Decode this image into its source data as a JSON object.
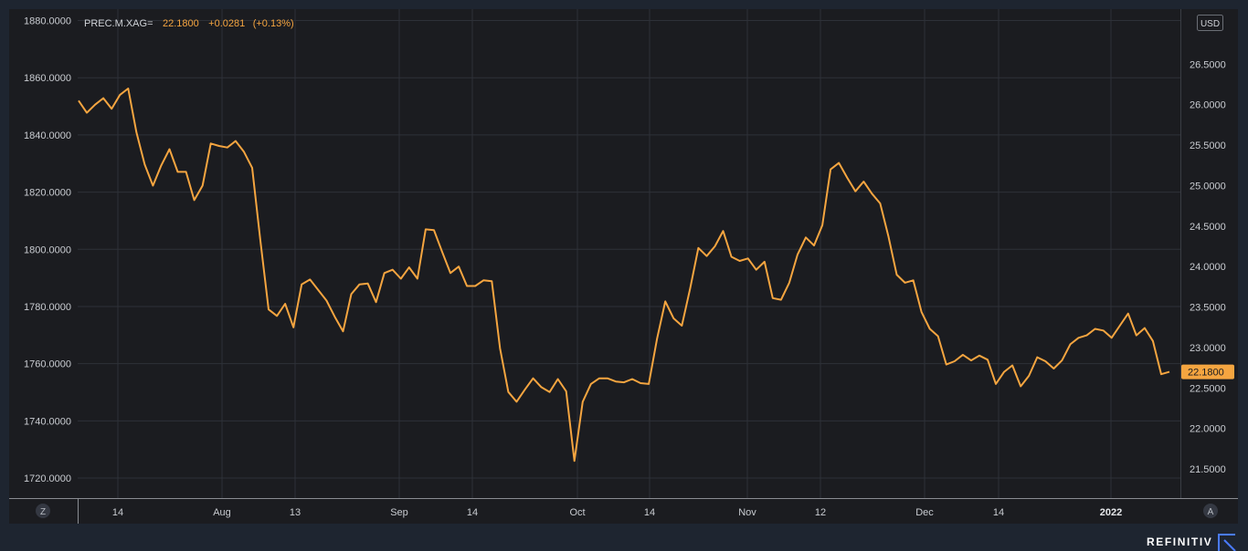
{
  "header": {
    "symbol": "PREC.M.XAG=",
    "last": "22.1800",
    "change": "+0.0281",
    "change_pct": "(+0.13%)"
  },
  "currency_badge": "USD",
  "last_price_tag": "22.1800",
  "zoom_button": "Z",
  "autoscale_button": "A",
  "brand": "REFINITIV",
  "colors": {
    "background": "#1e2530",
    "plot": "#1b1c20",
    "line": "#f5a540",
    "grid": "#2e3138"
  },
  "chart_data": {
    "type": "line",
    "left_axis": {
      "range": [
        1713,
        1884
      ],
      "ticks": [
        "1880.0000",
        "1860.0000",
        "1840.0000",
        "1820.0000",
        "1800.0000",
        "1780.0000",
        "1760.0000",
        "1740.0000",
        "1720.0000"
      ]
    },
    "right_axis": {
      "range": [
        21.14,
        27.18
      ],
      "ticks": [
        "26.5000",
        "26.0000",
        "25.5000",
        "25.0000",
        "24.5000",
        "24.0000",
        "23.5000",
        "23.0000",
        "22.5000",
        "22.0000",
        "21.5000"
      ]
    },
    "x_ticks": [
      {
        "label": "14",
        "bold": false
      },
      {
        "label": "Aug",
        "bold": false
      },
      {
        "label": "13",
        "bold": false
      },
      {
        "label": "Sep",
        "bold": false
      },
      {
        "label": "14",
        "bold": false
      },
      {
        "label": "Oct",
        "bold": false
      },
      {
        "label": "14",
        "bold": false
      },
      {
        "label": "Nov",
        "bold": false
      },
      {
        "label": "12",
        "bold": false
      },
      {
        "label": "Dec",
        "bold": false
      },
      {
        "label": "14",
        "bold": false
      },
      {
        "label": "2022",
        "bold": true
      }
    ],
    "grid": true,
    "series": [
      {
        "values": [
          26.05,
          25.9,
          26.0,
          26.08,
          25.95,
          26.12,
          26.2,
          25.66,
          25.26,
          25.0,
          25.25,
          25.45,
          25.17,
          25.17,
          24.82,
          25.0,
          25.52,
          25.49,
          25.47,
          25.55,
          25.42,
          25.22,
          24.32,
          23.47,
          23.39,
          23.54,
          23.25,
          23.78,
          23.84,
          23.71,
          23.58,
          23.38,
          23.2,
          23.66,
          23.78,
          23.79,
          23.56,
          23.92,
          23.96,
          23.85,
          23.99,
          23.85,
          24.46,
          24.45,
          24.18,
          23.92,
          24.0,
          23.76,
          23.76,
          23.83,
          23.82,
          22.99,
          22.45,
          22.33,
          22.48,
          22.62,
          22.51,
          22.45,
          22.61,
          22.46,
          21.6,
          22.33,
          22.55,
          22.62,
          22.62,
          22.58,
          22.57,
          22.61,
          22.56,
          22.55,
          23.11,
          23.57,
          23.36,
          23.27,
          23.73,
          24.23,
          24.13,
          24.25,
          24.44,
          24.12,
          24.07,
          24.1,
          23.96,
          24.06,
          23.61,
          23.59,
          23.8,
          24.15,
          24.36,
          24.26,
          24.51,
          25.2,
          25.28,
          25.1,
          24.93,
          25.05,
          24.9,
          24.78,
          24.37,
          23.9,
          23.8,
          23.83,
          23.44,
          23.23,
          23.14,
          22.79,
          22.83,
          22.91,
          22.84,
          22.9,
          22.85,
          22.55,
          22.7,
          22.78,
          22.52,
          22.65,
          22.88,
          22.83,
          22.74,
          22.84,
          23.04,
          23.12,
          23.15,
          23.23,
          23.21,
          23.12,
          23.27,
          23.42,
          23.15,
          23.24,
          23.08,
          22.67,
          22.7
        ]
      }
    ]
  }
}
